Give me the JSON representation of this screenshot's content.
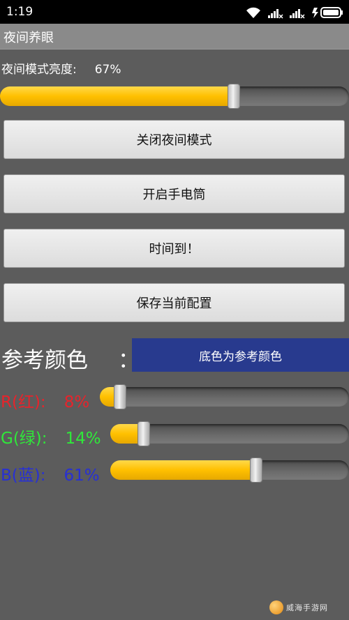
{
  "status_bar": {
    "time": "1:19",
    "icons": [
      "wifi-icon",
      "signal-1-icon",
      "signal-2-icon",
      "battery-charging-icon"
    ]
  },
  "title_bar": {
    "title": "夜间养眼"
  },
  "brightness": {
    "label": "夜间模式亮度:",
    "value_text": "67%",
    "level": 0.67,
    "fill_color": "#ffc000"
  },
  "buttons": [
    {
      "label": "关闭夜间模式"
    },
    {
      "label": "开启手电筒"
    },
    {
      "label": "时间到！"
    },
    {
      "label": "保存当前配置"
    }
  ],
  "reference_color": {
    "label": "参考颜色",
    "colon": "：",
    "box_text": "底色为参考颜色",
    "box_color": "#283a8e"
  },
  "rgb": [
    {
      "label": "R(红):",
      "value_text": "8%",
      "level": 0.08,
      "color": "#e8232b"
    },
    {
      "label": "G(绿):",
      "value_text": "14%",
      "level": 0.14,
      "color": "#2fe83a"
    },
    {
      "label": "B(蓝):",
      "value_text": "61%",
      "level": 0.61,
      "color": "#2730d4"
    }
  ],
  "watermark": {
    "text": "威海手游网"
  }
}
